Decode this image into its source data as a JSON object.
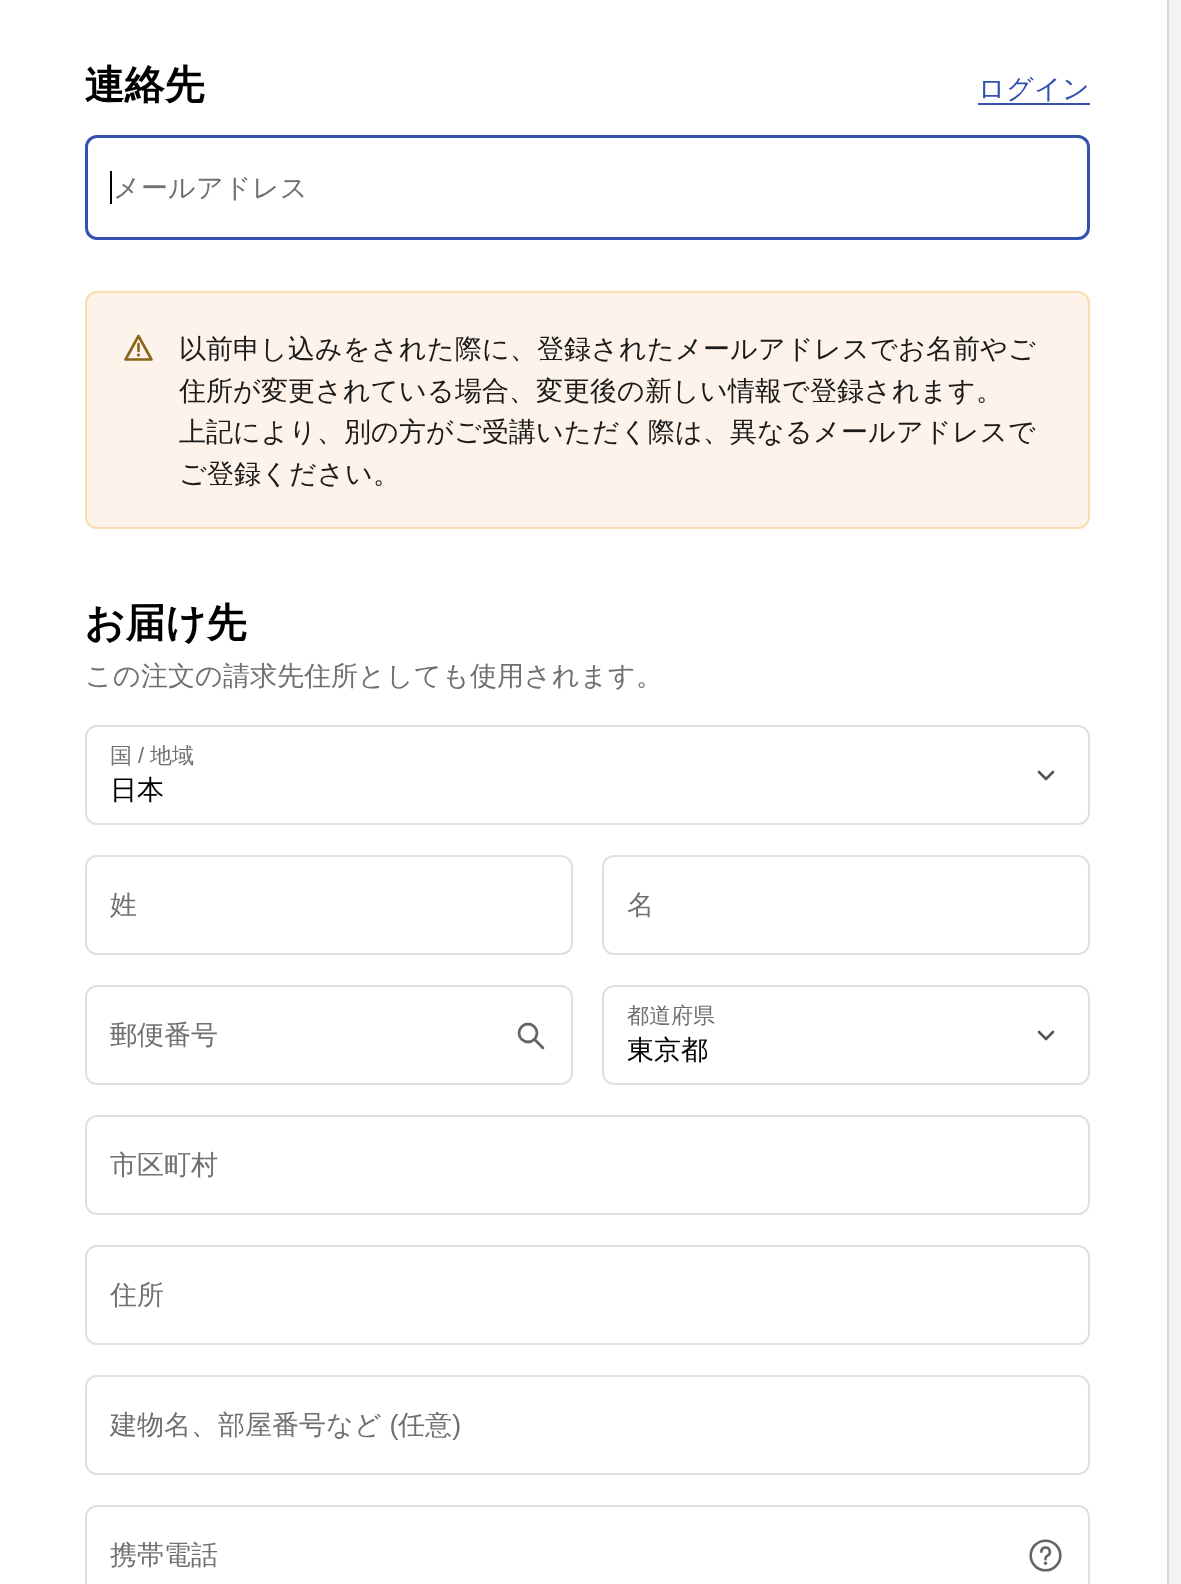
{
  "contact": {
    "title": "連絡先",
    "login_link": "ログイン",
    "email_field": {
      "placeholder": "メールアドレス",
      "focused": true
    }
  },
  "notice": {
    "paragraphs": [
      "以前申し込みをされた際に、登録されたメールアドレスでお名前やご住所が変更されている場合、変更後の新しい情報で登録されます。",
      "上記により、別の方がご受講いただく際は、異なるメールアドレスでご登録ください。"
    ]
  },
  "shipping": {
    "title": "お届け先",
    "subtitle": "この注文の請求先住所としても使用されます。",
    "rows": [
      {
        "fields": [
          {
            "kind": "select",
            "label": "国 / 地域",
            "value": "日本"
          }
        ]
      },
      {
        "fields": [
          {
            "kind": "text",
            "placeholder": "姓"
          },
          {
            "kind": "text",
            "placeholder": "名"
          }
        ]
      },
      {
        "fields": [
          {
            "kind": "postal",
            "placeholder": "郵便番号"
          },
          {
            "kind": "select",
            "label": "都道府県",
            "value": "東京都"
          }
        ]
      },
      {
        "fields": [
          {
            "kind": "text",
            "placeholder": "市区町村"
          }
        ]
      },
      {
        "fields": [
          {
            "kind": "text",
            "placeholder": "住所"
          }
        ]
      },
      {
        "fields": [
          {
            "kind": "text",
            "placeholder": "建物名、部屋番号など (任意)"
          }
        ]
      },
      {
        "fields": [
          {
            "kind": "phone",
            "placeholder": "携帯電話"
          }
        ]
      }
    ]
  }
}
